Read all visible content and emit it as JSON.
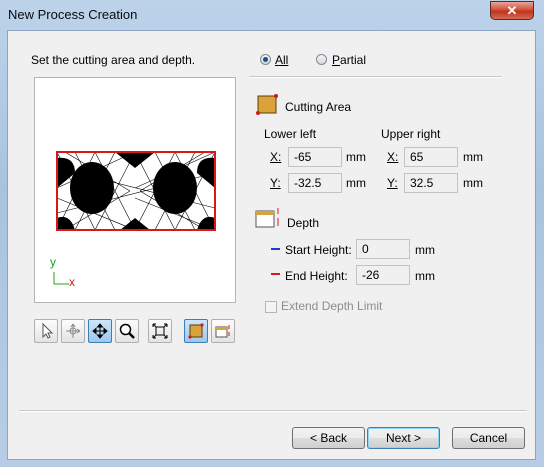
{
  "window": {
    "title": "New Process Creation",
    "close_glyph": "✕"
  },
  "instruction": "Set the cutting area and depth.",
  "area_mode": {
    "all_label": "All",
    "partial_label": "Partial",
    "selected": "All"
  },
  "cutting_area": {
    "heading": "Cutting Area",
    "lower_left_label": "Lower left",
    "upper_right_label": "Upper right",
    "x_label": "X:",
    "y_label": "Y:",
    "lower_left_x": "-65",
    "lower_left_y": "-32.5",
    "upper_right_x": "65",
    "upper_right_y": "32.5",
    "unit": "mm"
  },
  "depth": {
    "heading": "Depth",
    "start_label": "Start Height:",
    "end_label": "End Height:",
    "start_value": "0",
    "end_value": "-26",
    "unit": "mm",
    "start_color": "#1b3fd6",
    "end_color": "#d21a1a",
    "extend_label": "Extend Depth Limit",
    "extend_checked": false
  },
  "preview": {
    "axis_y": "y",
    "axis_x": "x"
  },
  "toolbar": {
    "tools": [
      "select-icon",
      "pan-rotate-icon",
      "move-icon",
      "zoom-icon",
      "fit-view-icon",
      "area-icon",
      "depth-icon"
    ],
    "active": [
      "move-icon",
      "area-icon"
    ]
  },
  "buttons": {
    "back": "< Back",
    "next": "Next >",
    "cancel": "Cancel"
  }
}
